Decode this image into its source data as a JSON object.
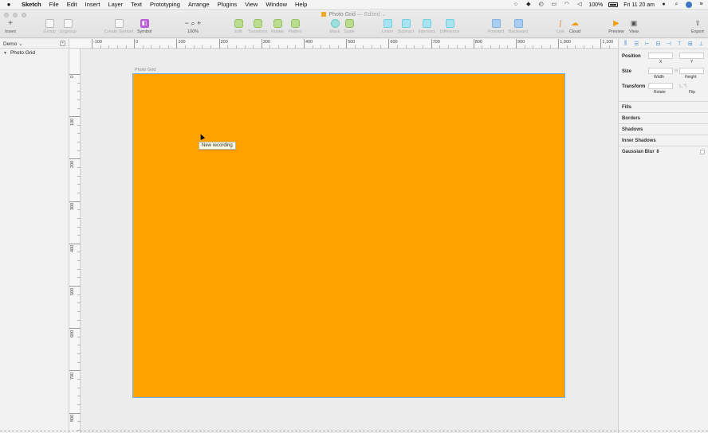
{
  "menubar": {
    "app_name": "Sketch",
    "items": [
      "File",
      "Edit",
      "Insert",
      "Layer",
      "Text",
      "Prototyping",
      "Arrange",
      "Plugins",
      "View",
      "Window",
      "Help"
    ],
    "battery": "100%",
    "clock": "Fri 11 20 am"
  },
  "window": {
    "title": "Photo Grid",
    "title_suffix": "— Edited ⌄"
  },
  "toolbar": {
    "insert": "Insert",
    "group": "Group",
    "ungroup": "Ungroup",
    "create_symbol": "Create Symbol",
    "symbol": "Symbol",
    "zoom_value": "100%",
    "edit": "Edit",
    "transform": "Transform",
    "rotate": "Rotate",
    "flatten": "Flatten",
    "mask": "Mask",
    "scale": "Scale",
    "union": "Union",
    "subtract": "Subtract",
    "intersect": "Intersect",
    "difference": "Difference",
    "forward": "Forward",
    "backward": "Backward",
    "link": "Link",
    "cloud": "Cloud",
    "preview": "Preview",
    "view": "View",
    "export": "Export"
  },
  "left_panel": {
    "page_name": "Demo ⌄",
    "add_page": "+",
    "layers": [
      {
        "name": "Photo Grid",
        "disclosure": "▼"
      }
    ]
  },
  "ruler": {
    "h_labels": [
      "-100",
      "0",
      "100",
      "200",
      "300",
      "400",
      "500",
      "600",
      "700",
      "800",
      "900",
      "1,000",
      "1,100"
    ],
    "v_labels": [
      "0",
      "100",
      "200",
      "300",
      "400",
      "500",
      "600",
      "700",
      "800"
    ]
  },
  "canvas": {
    "artboard_name": "Photo Grid",
    "artboard_color": "#ffa200",
    "tooltip": "New recording"
  },
  "inspector": {
    "position_label": "Position",
    "x_label": "X",
    "y_label": "Y",
    "size_label": "Size",
    "width_label": "Width",
    "height_label": "Height",
    "transform_label": "Transform",
    "rotate_label": "Rotate",
    "flip_label": "Flip",
    "sections": [
      "Fills",
      "Borders",
      "Shadows",
      "Inner Shadows",
      "Gaussian Blur ⇕"
    ]
  }
}
